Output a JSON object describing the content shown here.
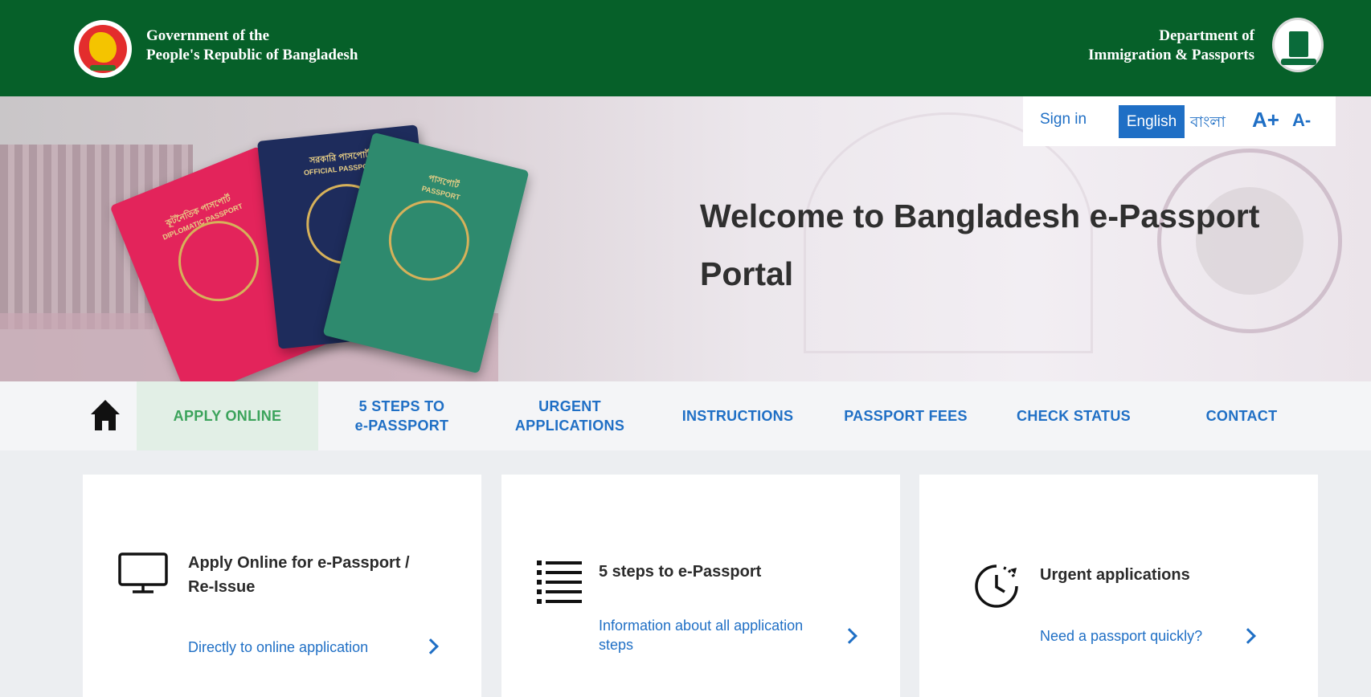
{
  "header": {
    "gov_line1": "Government of the",
    "gov_line2": "People's Republic of Bangladesh",
    "dept_line1": "Department of",
    "dept_line2": "Immigration & Passports"
  },
  "hero": {
    "welcome": "Welcome to Bangladesh e-Passport Portal",
    "passports": {
      "diplomatic_bn": "কূটনৈতিক পাসপোর্ট",
      "diplomatic_en": "DIPLOMATIC PASSPORT",
      "official_bn": "সরকারি পাসপোর্ট",
      "official_en": "OFFICIAL PASSPORT",
      "regular_bn": "পাসপোর্ট",
      "regular_en": "PASSPORT"
    }
  },
  "utility": {
    "sign_in": "Sign in",
    "lang_english": "English",
    "lang_bangla": "বাংলা",
    "font_increase": "A+",
    "font_decrease": "A-"
  },
  "nav": {
    "items": [
      {
        "label": "APPLY ONLINE"
      },
      {
        "line1": "5 STEPS TO",
        "line2": "e-PASSPORT"
      },
      {
        "line1": "URGENT",
        "line2": "APPLICATIONS"
      },
      {
        "label": "INSTRUCTIONS"
      },
      {
        "label": "PASSPORT FEES"
      },
      {
        "label": "CHECK STATUS"
      },
      {
        "label": "CONTACT"
      }
    ]
  },
  "cards": [
    {
      "title_line1": "Apply Online for e-Passport /",
      "title_line2": "Re-Issue",
      "link": "Directly to online application",
      "icon": "monitor-icon"
    },
    {
      "title": "5 steps to e-Passport",
      "link_line1": "Information about all application",
      "link_line2": "steps",
      "icon": "list-icon"
    },
    {
      "title": "Urgent applications",
      "link": "Need a passport quickly?",
      "icon": "clock-icon"
    }
  ],
  "colors": {
    "header_green": "#066029",
    "link_blue": "#1f6fc5",
    "active_green": "#3ba35b"
  }
}
